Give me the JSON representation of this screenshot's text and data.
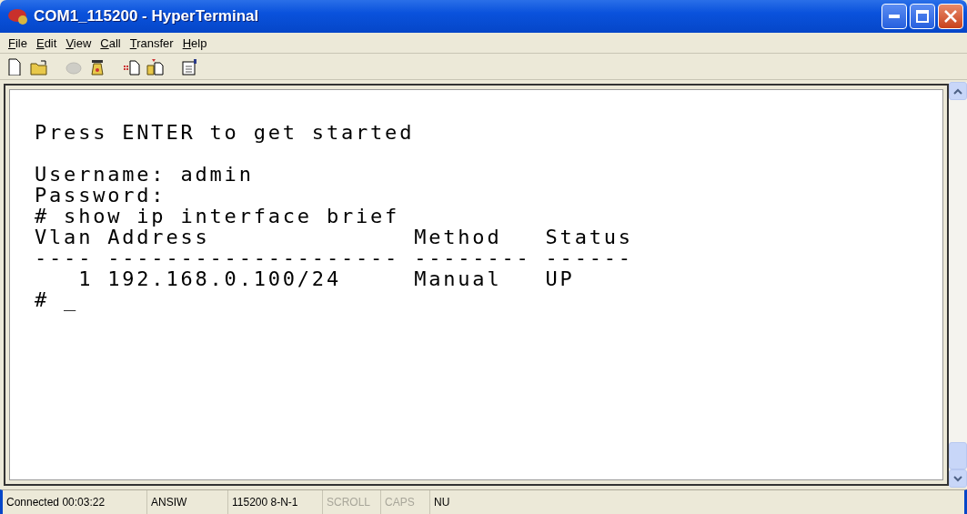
{
  "window": {
    "title": "COM1_115200 - HyperTerminal"
  },
  "menu": [
    {
      "label": "File"
    },
    {
      "label": "Edit"
    },
    {
      "label": "View"
    },
    {
      "label": "Call"
    },
    {
      "label": "Transfer"
    },
    {
      "label": "Help"
    }
  ],
  "toolbar": [
    {
      "kind": "new",
      "disabled": false
    },
    {
      "kind": "open",
      "disabled": false
    },
    {
      "kind": "disconnect",
      "disabled": true
    },
    {
      "kind": "dial",
      "disabled": false
    },
    {
      "kind": "send",
      "disabled": false
    },
    {
      "kind": "receive",
      "disabled": false
    },
    {
      "kind": "properties",
      "disabled": false
    }
  ],
  "terminal": {
    "blocks": [
      [
        "Press ENTER to get started"
      ],
      [
        "Username: admin",
        "Password:",
        "# show ip interface brief",
        "Vlan Address              Method   Status",
        "---- -------------------- -------- ------",
        "   1 192.168.0.100/24     Manual   UP",
        "# _"
      ]
    ]
  },
  "status_bar": [
    {
      "text": "Connected 00:03:22",
      "disabled": false
    },
    {
      "text": "ANSIW",
      "disabled": false
    },
    {
      "text": "115200 8-N-1",
      "disabled": false
    },
    {
      "text": "SCROLL",
      "disabled": true
    },
    {
      "text": "CAPS",
      "disabled": true
    },
    {
      "text": "NU",
      "disabled": false
    }
  ]
}
